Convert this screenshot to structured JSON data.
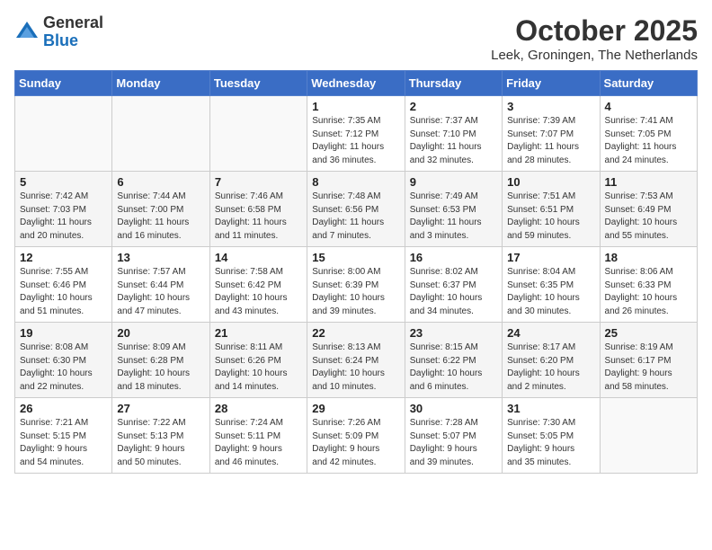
{
  "header": {
    "logo_general": "General",
    "logo_blue": "Blue",
    "month": "October 2025",
    "location": "Leek, Groningen, The Netherlands"
  },
  "weekdays": [
    "Sunday",
    "Monday",
    "Tuesday",
    "Wednesday",
    "Thursday",
    "Friday",
    "Saturday"
  ],
  "weeks": [
    [
      {
        "day": "",
        "info": ""
      },
      {
        "day": "",
        "info": ""
      },
      {
        "day": "",
        "info": ""
      },
      {
        "day": "1",
        "info": "Sunrise: 7:35 AM\nSunset: 7:12 PM\nDaylight: 11 hours\nand 36 minutes."
      },
      {
        "day": "2",
        "info": "Sunrise: 7:37 AM\nSunset: 7:10 PM\nDaylight: 11 hours\nand 32 minutes."
      },
      {
        "day": "3",
        "info": "Sunrise: 7:39 AM\nSunset: 7:07 PM\nDaylight: 11 hours\nand 28 minutes."
      },
      {
        "day": "4",
        "info": "Sunrise: 7:41 AM\nSunset: 7:05 PM\nDaylight: 11 hours\nand 24 minutes."
      }
    ],
    [
      {
        "day": "5",
        "info": "Sunrise: 7:42 AM\nSunset: 7:03 PM\nDaylight: 11 hours\nand 20 minutes."
      },
      {
        "day": "6",
        "info": "Sunrise: 7:44 AM\nSunset: 7:00 PM\nDaylight: 11 hours\nand 16 minutes."
      },
      {
        "day": "7",
        "info": "Sunrise: 7:46 AM\nSunset: 6:58 PM\nDaylight: 11 hours\nand 11 minutes."
      },
      {
        "day": "8",
        "info": "Sunrise: 7:48 AM\nSunset: 6:56 PM\nDaylight: 11 hours\nand 7 minutes."
      },
      {
        "day": "9",
        "info": "Sunrise: 7:49 AM\nSunset: 6:53 PM\nDaylight: 11 hours\nand 3 minutes."
      },
      {
        "day": "10",
        "info": "Sunrise: 7:51 AM\nSunset: 6:51 PM\nDaylight: 10 hours\nand 59 minutes."
      },
      {
        "day": "11",
        "info": "Sunrise: 7:53 AM\nSunset: 6:49 PM\nDaylight: 10 hours\nand 55 minutes."
      }
    ],
    [
      {
        "day": "12",
        "info": "Sunrise: 7:55 AM\nSunset: 6:46 PM\nDaylight: 10 hours\nand 51 minutes."
      },
      {
        "day": "13",
        "info": "Sunrise: 7:57 AM\nSunset: 6:44 PM\nDaylight: 10 hours\nand 47 minutes."
      },
      {
        "day": "14",
        "info": "Sunrise: 7:58 AM\nSunset: 6:42 PM\nDaylight: 10 hours\nand 43 minutes."
      },
      {
        "day": "15",
        "info": "Sunrise: 8:00 AM\nSunset: 6:39 PM\nDaylight: 10 hours\nand 39 minutes."
      },
      {
        "day": "16",
        "info": "Sunrise: 8:02 AM\nSunset: 6:37 PM\nDaylight: 10 hours\nand 34 minutes."
      },
      {
        "day": "17",
        "info": "Sunrise: 8:04 AM\nSunset: 6:35 PM\nDaylight: 10 hours\nand 30 minutes."
      },
      {
        "day": "18",
        "info": "Sunrise: 8:06 AM\nSunset: 6:33 PM\nDaylight: 10 hours\nand 26 minutes."
      }
    ],
    [
      {
        "day": "19",
        "info": "Sunrise: 8:08 AM\nSunset: 6:30 PM\nDaylight: 10 hours\nand 22 minutes."
      },
      {
        "day": "20",
        "info": "Sunrise: 8:09 AM\nSunset: 6:28 PM\nDaylight: 10 hours\nand 18 minutes."
      },
      {
        "day": "21",
        "info": "Sunrise: 8:11 AM\nSunset: 6:26 PM\nDaylight: 10 hours\nand 14 minutes."
      },
      {
        "day": "22",
        "info": "Sunrise: 8:13 AM\nSunset: 6:24 PM\nDaylight: 10 hours\nand 10 minutes."
      },
      {
        "day": "23",
        "info": "Sunrise: 8:15 AM\nSunset: 6:22 PM\nDaylight: 10 hours\nand 6 minutes."
      },
      {
        "day": "24",
        "info": "Sunrise: 8:17 AM\nSunset: 6:20 PM\nDaylight: 10 hours\nand 2 minutes."
      },
      {
        "day": "25",
        "info": "Sunrise: 8:19 AM\nSunset: 6:17 PM\nDaylight: 9 hours\nand 58 minutes."
      }
    ],
    [
      {
        "day": "26",
        "info": "Sunrise: 7:21 AM\nSunset: 5:15 PM\nDaylight: 9 hours\nand 54 minutes."
      },
      {
        "day": "27",
        "info": "Sunrise: 7:22 AM\nSunset: 5:13 PM\nDaylight: 9 hours\nand 50 minutes."
      },
      {
        "day": "28",
        "info": "Sunrise: 7:24 AM\nSunset: 5:11 PM\nDaylight: 9 hours\nand 46 minutes."
      },
      {
        "day": "29",
        "info": "Sunrise: 7:26 AM\nSunset: 5:09 PM\nDaylight: 9 hours\nand 42 minutes."
      },
      {
        "day": "30",
        "info": "Sunrise: 7:28 AM\nSunset: 5:07 PM\nDaylight: 9 hours\nand 39 minutes."
      },
      {
        "day": "31",
        "info": "Sunrise: 7:30 AM\nSunset: 5:05 PM\nDaylight: 9 hours\nand 35 minutes."
      },
      {
        "day": "",
        "info": ""
      }
    ]
  ]
}
